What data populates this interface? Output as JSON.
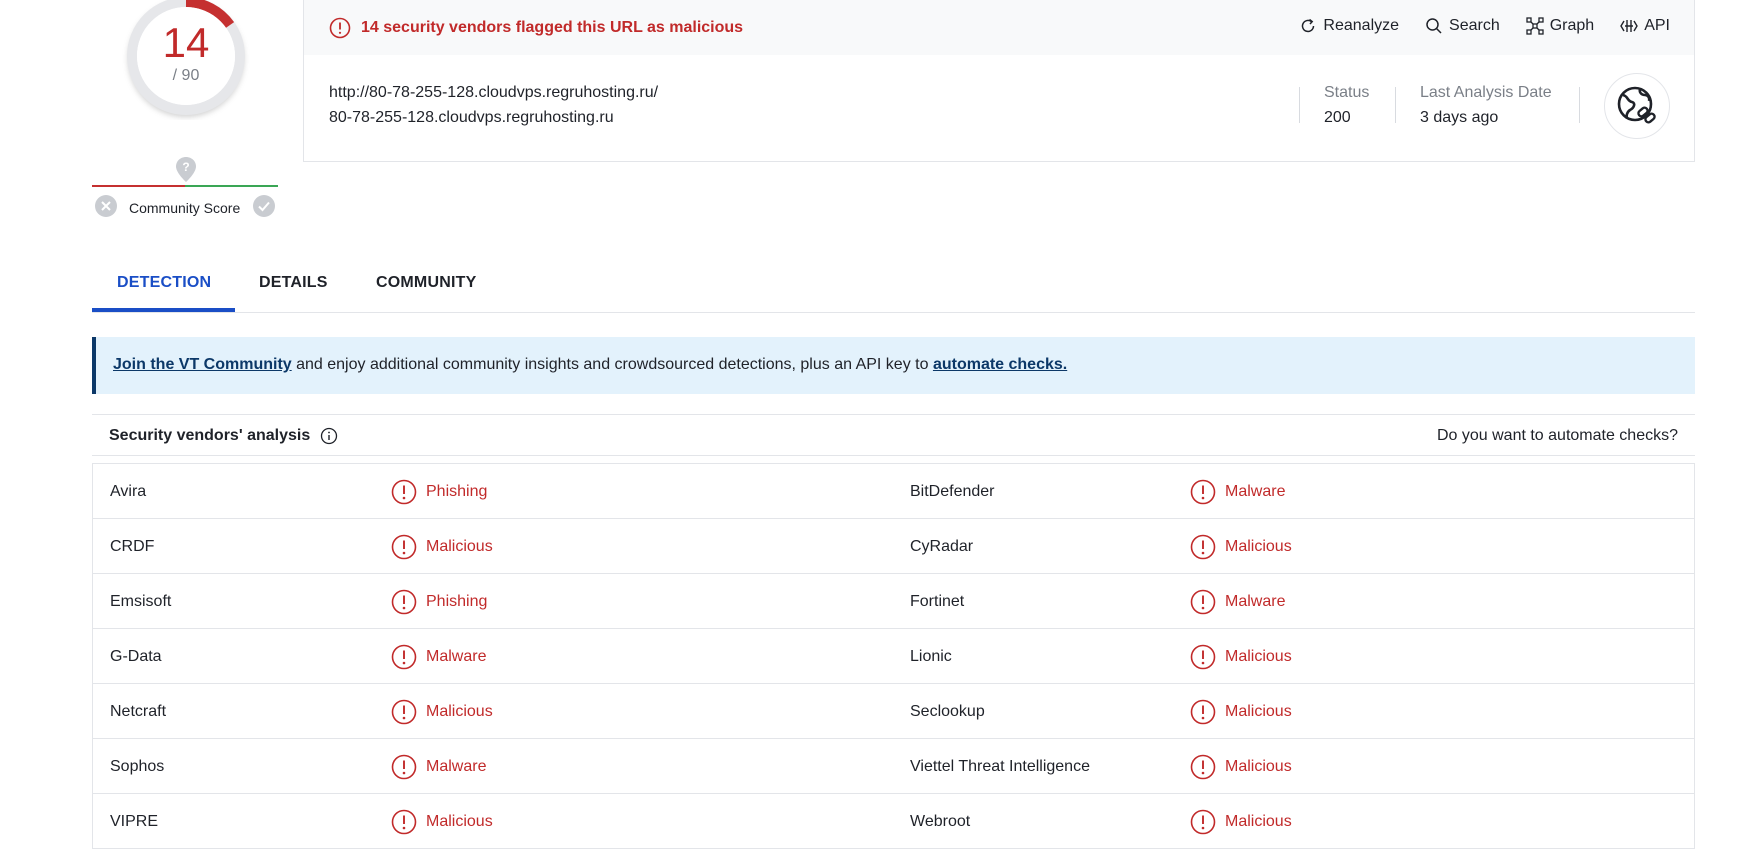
{
  "score": {
    "detections": "14",
    "total": "/ 90"
  },
  "community": {
    "label": "Community Score"
  },
  "alert": {
    "text": "14 security vendors flagged this URL as malicious"
  },
  "actions": [
    {
      "label": "Reanalyze",
      "icon": "reanalyze-icon"
    },
    {
      "label": "Search",
      "icon": "search-icon"
    },
    {
      "label": "Graph",
      "icon": "graph-icon"
    },
    {
      "label": "API",
      "icon": "api-icon"
    }
  ],
  "url": {
    "full": "http://80-78-255-128.cloudvps.regruhosting.ru/",
    "host": "80-78-255-128.cloudvps.regruhosting.ru"
  },
  "meta": {
    "status_label": "Status",
    "status_value": "200",
    "date_label": "Last Analysis Date",
    "date_value": "3 days ago"
  },
  "tabs": [
    {
      "label": "DETECTION"
    },
    {
      "label": "DETAILS"
    },
    {
      "label": "COMMUNITY"
    }
  ],
  "banner": {
    "link1": "Join the VT Community",
    "middle": " and enjoy additional community insights and crowdsourced detections, plus an API key to ",
    "link2": "automate checks."
  },
  "analysis": {
    "title": "Security vendors' analysis",
    "right": "Do you want to automate checks?",
    "rows": [
      {
        "v1": "Avira",
        "r1": "Phishing",
        "v2": "BitDefender",
        "r2": "Malware"
      },
      {
        "v1": "CRDF",
        "r1": "Malicious",
        "v2": "CyRadar",
        "r2": "Malicious"
      },
      {
        "v1": "Emsisoft",
        "r1": "Phishing",
        "v2": "Fortinet",
        "r2": "Malware"
      },
      {
        "v1": "G-Data",
        "r1": "Malware",
        "v2": "Lionic",
        "r2": "Malicious"
      },
      {
        "v1": "Netcraft",
        "r1": "Malicious",
        "v2": "Seclookup",
        "r2": "Malicious"
      },
      {
        "v1": "Sophos",
        "r1": "Malware",
        "v2": "Viettel Threat Intelligence",
        "r2": "Malicious"
      },
      {
        "v1": "VIPRE",
        "r1": "Malicious",
        "v2": "Webroot",
        "r2": "Malicious"
      }
    ]
  },
  "colors": {
    "danger": "#c12a2a",
    "accent": "#1a4ec6",
    "banner_bg": "#e3f2fc",
    "banner_border": "#0c3868"
  }
}
